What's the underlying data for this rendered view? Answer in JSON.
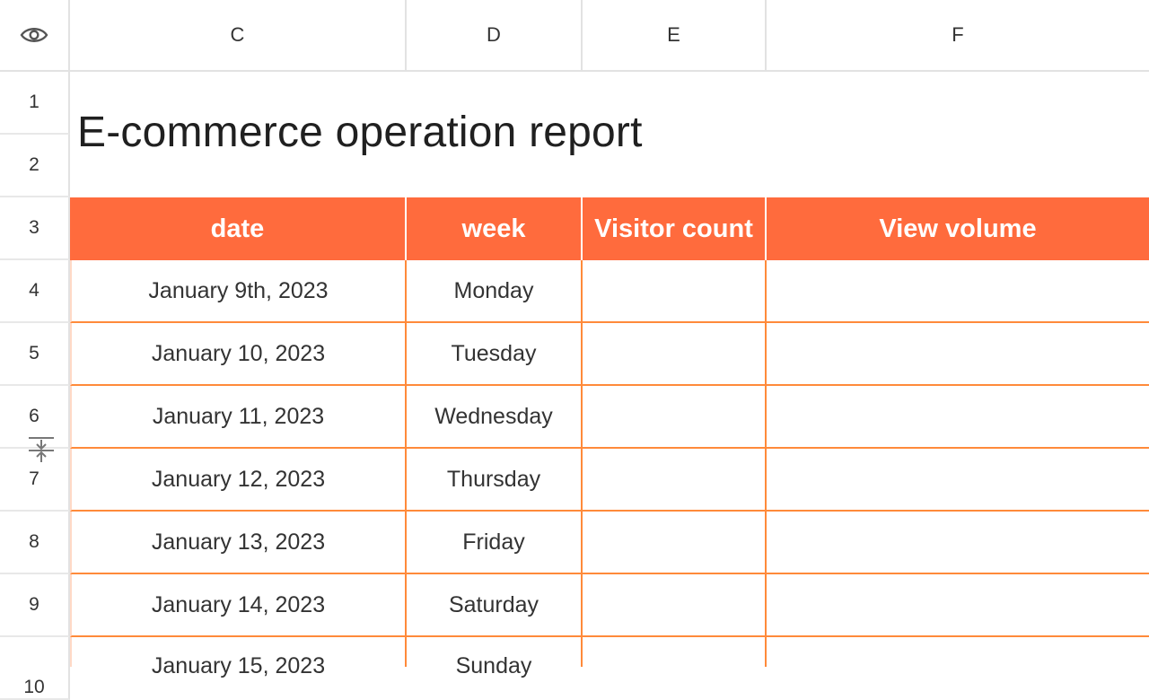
{
  "columns": [
    "C",
    "D",
    "E",
    "F"
  ],
  "rows": [
    "1",
    "2",
    "3",
    "4",
    "5",
    "6",
    "7",
    "8",
    "9",
    "10"
  ],
  "title": "E-commerce operation report",
  "table": {
    "headers": [
      "date",
      "week",
      "Visitor count",
      "View volume"
    ],
    "data": [
      [
        "January 9th, 2023",
        "Monday",
        "",
        ""
      ],
      [
        "January 10, 2023",
        "Tuesday",
        "",
        ""
      ],
      [
        "January 11, 2023",
        "Wednesday",
        "",
        ""
      ],
      [
        "January 12, 2023",
        "Thursday",
        "",
        ""
      ],
      [
        "January 13, 2023",
        "Friday",
        "",
        ""
      ],
      [
        "January 14, 2023",
        "Saturday",
        "",
        ""
      ],
      [
        "January 15, 2023",
        "Sunday",
        "",
        ""
      ]
    ]
  },
  "colors": {
    "header_fill": "#ff6b3d",
    "border_accent": "#ff8a3a"
  },
  "icons": {
    "visibility": "eye-icon",
    "row_resize": "row-resize-icon"
  }
}
